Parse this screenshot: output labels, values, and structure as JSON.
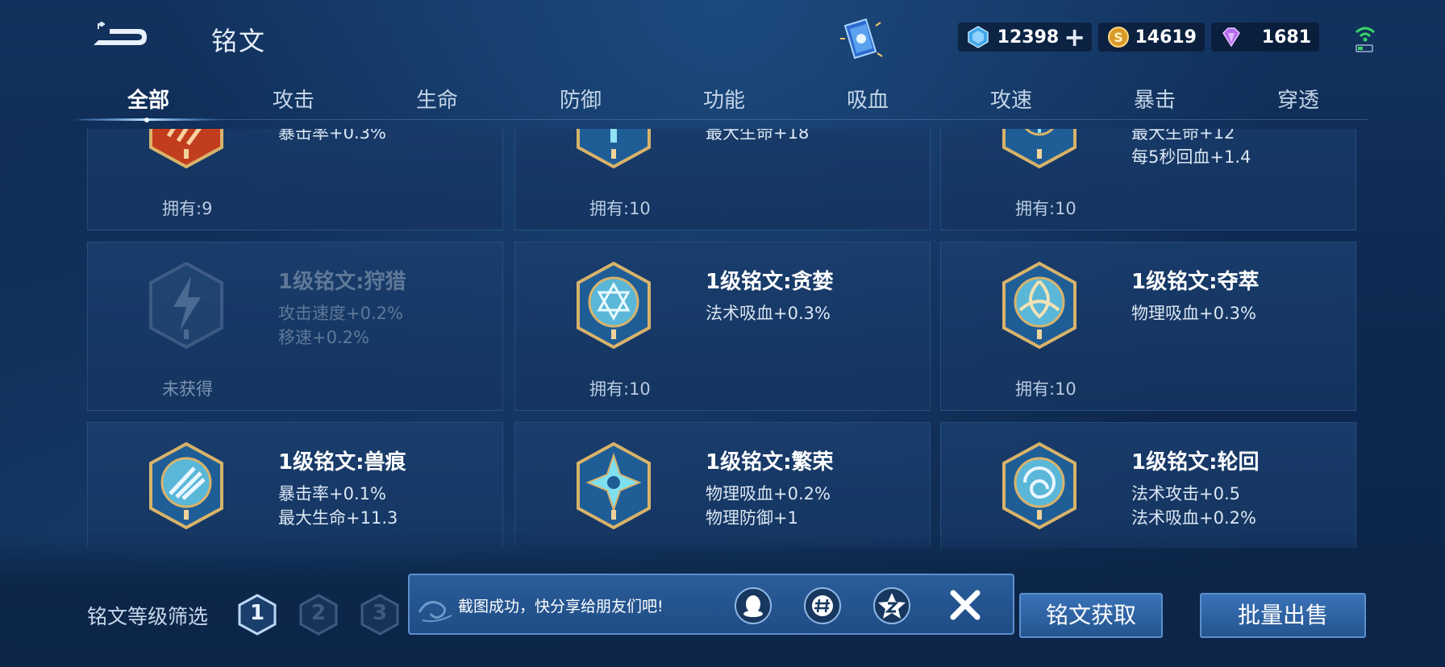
{
  "header": {
    "title": "铭文",
    "currencies": [
      {
        "icon": "diamond-icon",
        "value": "12398"
      },
      {
        "icon": "gold-coin-icon",
        "value": "14619"
      },
      {
        "icon": "purple-gem-icon",
        "value": "1681"
      }
    ],
    "plus_label": "+"
  },
  "tabs": [
    {
      "label": "全部",
      "active": true
    },
    {
      "label": "攻击"
    },
    {
      "label": "生命"
    },
    {
      "label": "防御"
    },
    {
      "label": "功能"
    },
    {
      "label": "吸血"
    },
    {
      "label": "攻速"
    },
    {
      "label": "暴击"
    },
    {
      "label": "穿透"
    }
  ],
  "cards": [
    {
      "name": "",
      "attrs": [
        "暴击率+0.3%"
      ],
      "owned": "拥有:9",
      "emblem": "red-claw-emblem-icon",
      "locked": false
    },
    {
      "name": "",
      "attrs": [
        "最大生命+18"
      ],
      "owned": "拥有:10",
      "emblem": "blue-cup-emblem-icon",
      "locked": false
    },
    {
      "name": "",
      "attrs": [
        "最大生命+12",
        "每5秒回血+1.4"
      ],
      "owned": "拥有:10",
      "emblem": "blue-rune-emblem-icon",
      "locked": false
    },
    {
      "name": "1级铭文:狩猎",
      "attrs": [
        "攻击速度+0.2%",
        "移速+0.2%"
      ],
      "owned": "未获得",
      "emblem": "lightning-emblem-icon",
      "locked": true
    },
    {
      "name": "1级铭文:贪婪",
      "attrs": [
        "法术吸血+0.3%"
      ],
      "owned": "拥有:10",
      "emblem": "hexagram-emblem-icon",
      "locked": false
    },
    {
      "name": "1级铭文:夺萃",
      "attrs": [
        "物理吸血+0.3%"
      ],
      "owned": "拥有:10",
      "emblem": "triquetra-emblem-icon",
      "locked": false
    },
    {
      "name": "1级铭文:兽痕",
      "attrs": [
        "暴击率+0.1%",
        "最大生命+11.3"
      ],
      "owned": "",
      "emblem": "claw-mark-emblem-icon",
      "locked": false
    },
    {
      "name": "1级铭文:繁荣",
      "attrs": [
        "物理吸血+0.2%",
        "物理防御+1"
      ],
      "owned": "",
      "emblem": "star-emblem-icon",
      "locked": false
    },
    {
      "name": "1级铭文:轮回",
      "attrs": [
        "法术攻击+0.5",
        "法术吸血+0.2%"
      ],
      "owned": "",
      "emblem": "spiral-emblem-icon",
      "locked": false
    }
  ],
  "filter": {
    "label": "铭文等级筛选",
    "levels": [
      "1",
      "2",
      "3"
    ],
    "selected": "1"
  },
  "toast": {
    "message": "截图成功，快分享给朋友们吧!",
    "share_targets": [
      "qq-icon",
      "wechat-moments-icon",
      "qzone-icon"
    ]
  },
  "buttons": {
    "get": "铭文获取",
    "sell": "批量出售"
  },
  "colors": {
    "background": "#0e2a52",
    "accent": "#5d8fcf",
    "gold_frame": "#c8a660"
  }
}
